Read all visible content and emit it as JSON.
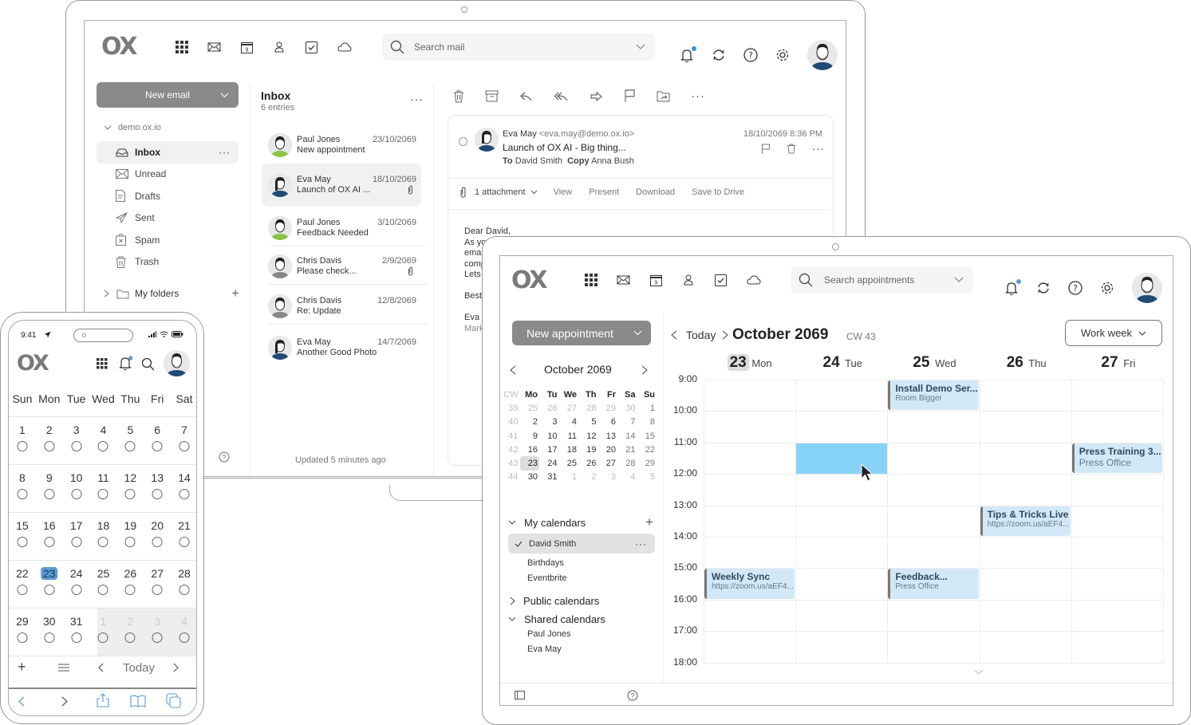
{
  "laptop": {
    "header": {
      "logo": "OX",
      "search_placeholder": "Search mail",
      "app_icons": [
        "apps-grid-icon",
        "mail-icon",
        "calendar-icon",
        "contacts-icon",
        "tasks-icon",
        "drive-icon"
      ],
      "right_icons": [
        "notifications-icon",
        "refresh-icon",
        "help-icon",
        "settings-icon"
      ]
    },
    "sidebar": {
      "new_button": "New email",
      "account": "demo.ox.io",
      "folders": [
        {
          "label": "Inbox",
          "icon": "inbox-icon",
          "active": true
        },
        {
          "label": "Unread",
          "icon": "unread-icon"
        },
        {
          "label": "Drafts",
          "icon": "drafts-icon"
        },
        {
          "label": "Sent",
          "icon": "sent-icon"
        },
        {
          "label": "Spam",
          "icon": "spam-icon"
        },
        {
          "label": "Trash",
          "icon": "trash-icon"
        }
      ],
      "my_folders": "My folders"
    },
    "list": {
      "title": "Inbox",
      "count": "6 entries",
      "items": [
        {
          "from": "Paul Jones",
          "date": "23/10/2069",
          "subject": "New appointment",
          "attachment": false,
          "avatar": "green"
        },
        {
          "from": "Eva May",
          "date": "18/10/2069",
          "subject": "Launch of OX AI ...",
          "attachment": true,
          "avatar": "blue",
          "selected": true
        },
        {
          "from": "Paul Jones",
          "date": "3/10/2069",
          "subject": "Feedback Needed",
          "attachment": false,
          "avatar": "green"
        },
        {
          "from": "Chris Davis",
          "date": "2/9/2069",
          "subject": "Please check...",
          "attachment": true,
          "avatar": "grey"
        },
        {
          "from": "Chris Davis",
          "date": "12/8/2069",
          "subject": "Re: Update",
          "attachment": false,
          "avatar": "grey"
        },
        {
          "from": "Eva May",
          "date": "14/7/2069",
          "subject": "Another Good Photo",
          "attachment": false,
          "avatar": "blue"
        }
      ],
      "footer": "Updated 5 minutes ago"
    },
    "detail": {
      "toolbar_icons": [
        "delete-icon",
        "archive-icon",
        "reply-icon",
        "reply-all-icon",
        "forward-icon",
        "flag-icon",
        "move-icon",
        "more-icon"
      ],
      "from_name": "Eva May",
      "from_email": "<eva.may@demo.ox.io>",
      "subject": "Launch of OX AI - Big thing...",
      "date": "18/10/2069 8:36 PM",
      "to_label": "To",
      "to": "David Smith",
      "copy_label": "Copy",
      "copy": "Anna Bush",
      "attachments": "1 attachment",
      "actions": [
        "View",
        "Present",
        "Download",
        "Save to Drive"
      ],
      "body_lines": [
        "Dear David,",
        "As yo",
        "emai",
        "comp",
        "Lets",
        "",
        "Best",
        "",
        "Eva M",
        "Mark"
      ]
    }
  },
  "tablet": {
    "header": {
      "logo": "OX",
      "search_placeholder": "Search appointments"
    },
    "sidebar": {
      "new_button": "New appointment",
      "mini_month": "October 2069",
      "mini_headers": [
        "CW",
        "Mo",
        "Tu",
        "We",
        "Th",
        "Fr",
        "Sa",
        "Su"
      ],
      "mini_weeks": [
        [
          "39",
          "25",
          "26",
          "27",
          "28",
          "29",
          "30",
          "1"
        ],
        [
          "40",
          "2",
          "3",
          "4",
          "5",
          "6",
          "7",
          "8"
        ],
        [
          "41",
          "9",
          "10",
          "11",
          "12",
          "13",
          "14",
          "15"
        ],
        [
          "42",
          "16",
          "17",
          "18",
          "19",
          "20",
          "21",
          "22"
        ],
        [
          "43",
          "23",
          "24",
          "25",
          "26",
          "27",
          "28",
          "29"
        ],
        [
          "44",
          "30",
          "31",
          "1",
          "2",
          "3",
          "4",
          "5"
        ]
      ],
      "my_calendars": "My calendars",
      "calendars": [
        "David Smith",
        "Birthdays",
        "Eventbrite"
      ],
      "public_calendars": "Public calendars",
      "shared_calendars": "Shared calendars",
      "shared": [
        "Paul Jones",
        "Eva May"
      ]
    },
    "main": {
      "today": "Today",
      "title": "October 2069",
      "cw": "CW 43",
      "view": "Work week",
      "days": [
        {
          "num": "23",
          "name": "Mon",
          "today": true
        },
        {
          "num": "24",
          "name": "Tue"
        },
        {
          "num": "25",
          "name": "Wed"
        },
        {
          "num": "26",
          "name": "Thu"
        },
        {
          "num": "27",
          "name": "Fri"
        }
      ],
      "hours": [
        "9:00",
        "10:00",
        "11:00",
        "12:00",
        "13:00",
        "14:00",
        "15:00",
        "16:00",
        "17:00",
        "18:00"
      ],
      "events": [
        {
          "day": 2,
          "start": 9,
          "end": 10,
          "title": "Install Demo Ser...",
          "sub": "Room Bigger"
        },
        {
          "day": 4,
          "start": 11,
          "end": 12,
          "title": "Press Training 3...",
          "sub": "Press Office"
        },
        {
          "day": 3,
          "start": 13,
          "end": 14,
          "title": "Tips & Tricks Live",
          "sub": "https://zoom.us/aEF4..."
        },
        {
          "day": 0,
          "start": 15,
          "end": 16,
          "title": "Weekly Sync",
          "sub": "https://zoom.us/aEF4..."
        },
        {
          "day": 2,
          "start": 15,
          "end": 16,
          "title": "Feedback...",
          "sub": "Press Office"
        }
      ],
      "selection": {
        "day": 1,
        "start": 11,
        "end": 12
      }
    }
  },
  "phone": {
    "status_time": "9:41",
    "logo": "OX",
    "weekdays": [
      "Sun",
      "Mon",
      "Tue",
      "Wed",
      "Thu",
      "Fri",
      "Sat"
    ],
    "weeks": [
      [
        "1",
        "2",
        "3",
        "4",
        "5",
        "6",
        "7"
      ],
      [
        "8",
        "9",
        "10",
        "11",
        "12",
        "13",
        "14"
      ],
      [
        "15",
        "16",
        "17",
        "18",
        "19",
        "20",
        "21"
      ],
      [
        "22",
        "23",
        "24",
        "25",
        "26",
        "27",
        "28"
      ],
      [
        "29",
        "30",
        "31",
        "1",
        "2",
        "3",
        "4"
      ]
    ],
    "today_label": "Today"
  },
  "colors": {
    "accent": "#5b9bd5",
    "event_bg": "#d3e8f7",
    "selection": "#87d3f8",
    "button_grey": "#8a8a8a"
  }
}
